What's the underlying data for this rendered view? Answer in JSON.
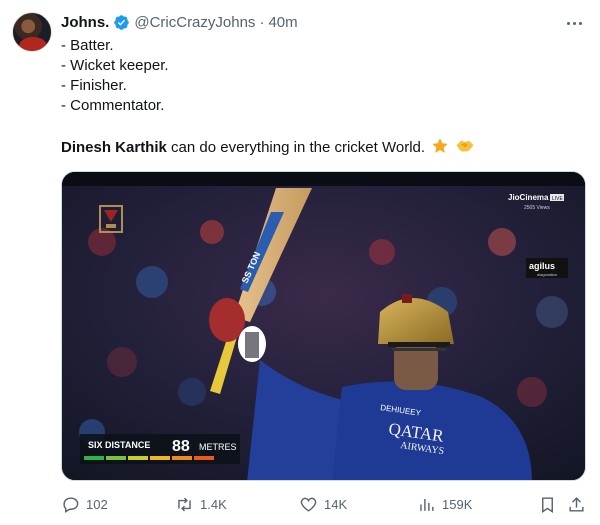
{
  "author": {
    "display_name": "Johns.",
    "handle": "@CricCrazyJohns",
    "time": "40m",
    "separator": "·"
  },
  "tweet": {
    "lines": [
      "- Batter.",
      "- Wicket keeper.",
      "- Finisher.",
      "- Commentator."
    ],
    "highlight_name": "Dinesh Karthik",
    "highlight_rest": " can do everything in the cricket World.",
    "emojis": [
      "star-icon",
      "handshake-icon"
    ]
  },
  "media": {
    "broadcaster": "JioCinema",
    "broadcaster_badge": "LIVE",
    "viewer_text": "2505 Views",
    "sponsor": "agilus",
    "sponsor_sub": "diagnostics",
    "bat_brand": "SS TON",
    "sixdist_label": "SIX DISTANCE",
    "sixdist_value": "88",
    "sixdist_unit": "METRES",
    "jersey_top": "DEHIUEEY",
    "jersey_main": "QATAR",
    "jersey_sub": "AIRWAYS"
  },
  "stats": {
    "replies": "102",
    "retweets": "1.4K",
    "likes": "14K",
    "views": "159K"
  },
  "colors": {
    "accent": "#1d9bf0",
    "muted": "#536471",
    "text": "#0f1419"
  }
}
